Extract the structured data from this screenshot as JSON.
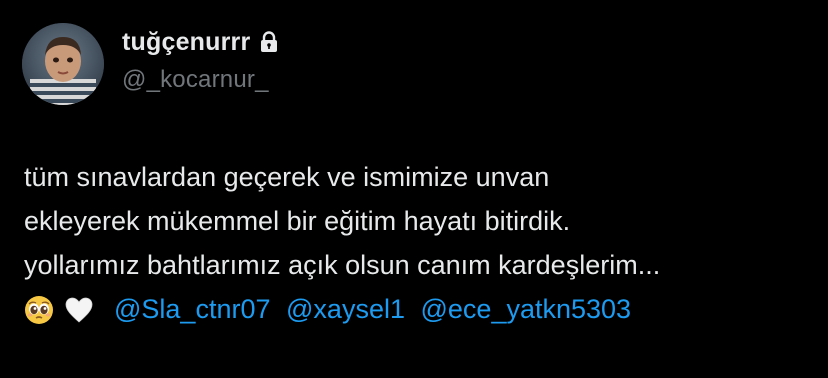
{
  "author": {
    "display_name": "tuğçenurrr",
    "handle": "@_kocarnur_",
    "avatar_icon": "avatar-photo-child",
    "protected_icon": "lock-icon"
  },
  "tweet": {
    "lines": [
      "tüm sınavlardan geçerek ve ismimize unvan",
      "ekleyerek mükemmel bir eğitim hayatı bitirdik.",
      "yollarımız bahtlarımız açık olsun canım kardeşlerim..."
    ],
    "emojis": [
      "pleading-face-emoji",
      "white-heart-emoji"
    ],
    "mentions": [
      "@Sla_ctnr07",
      "@xaysel1",
      "@ece_yatkn5303"
    ]
  },
  "colors": {
    "background": "#000000",
    "text": "#e7e9ea",
    "secondary_text": "#71767b",
    "mention": "#1d9bf0"
  }
}
